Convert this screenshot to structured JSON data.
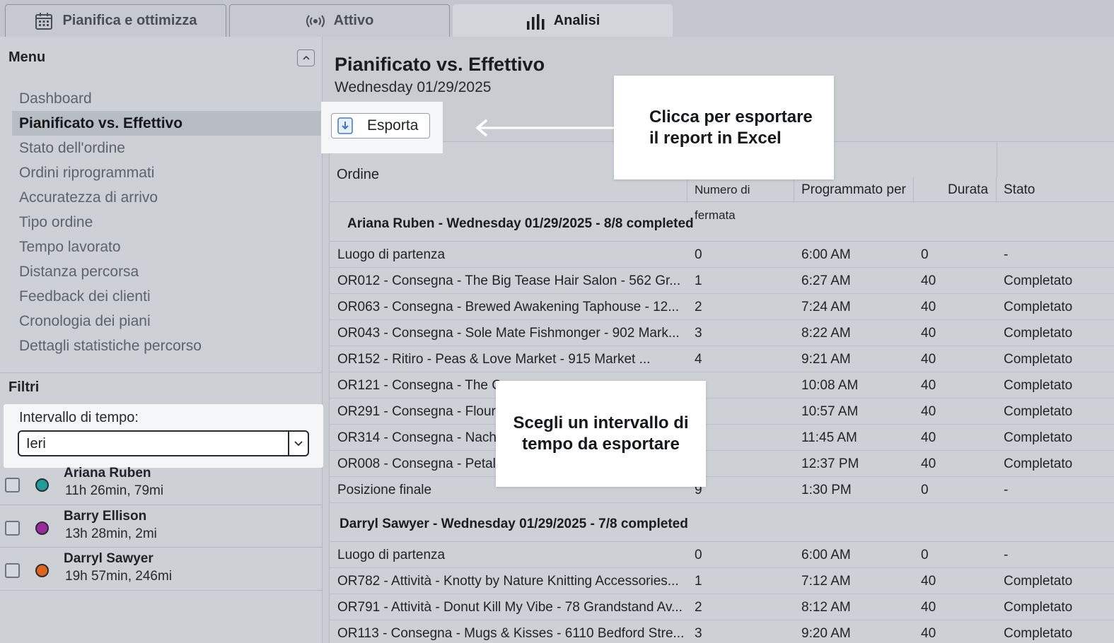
{
  "tabs": [
    {
      "label": "Pianifica e ottimizza",
      "icon": "calendar-icon"
    },
    {
      "label": "Attivo",
      "icon": "broadcast-icon"
    },
    {
      "label": "Analisi",
      "icon": "bar-chart-icon",
      "active": true
    }
  ],
  "sidebar": {
    "menu_title": "Menu",
    "items": [
      {
        "label": "Dashboard"
      },
      {
        "label": "Pianificato vs. Effettivo",
        "active": true
      },
      {
        "label": "Stato dell'ordine"
      },
      {
        "label": "Ordini riprogrammati"
      },
      {
        "label": "Accuratezza di arrivo"
      },
      {
        "label": "Tipo ordine"
      },
      {
        "label": "Tempo lavorato"
      },
      {
        "label": "Distanza percorsa"
      },
      {
        "label": "Feedback dei clienti"
      },
      {
        "label": "Cronologia dei piani"
      },
      {
        "label": "Dettagli statistiche percorso"
      }
    ],
    "filters_title": "Filtri",
    "time_range_label": "Intervallo di tempo:",
    "time_range_value": "Ieri",
    "drivers": [
      {
        "name": "Ariana Ruben",
        "stats": "11h 26min, 79mi",
        "color": "#1e9e99"
      },
      {
        "name": "Barry Ellison",
        "stats": "13h 28min, 2mi",
        "color": "#9b2a9e"
      },
      {
        "name": "Darryl Sawyer",
        "stats": "19h 57min, 246mi",
        "color": "#e0641c"
      }
    ]
  },
  "main": {
    "title": "Pianificato vs. Effettivo",
    "date": "Wednesday 01/29/2025",
    "export_label": "Esporta",
    "callout_export": "Clicca per esportare il report in Excel",
    "callout_range": "Scegli un intervallo di tempo da esportare",
    "columns": {
      "order": "Ordine",
      "stop": "Numero di fermata",
      "scheduled": "Programmato per",
      "duration": "Durata",
      "status": "Stato"
    },
    "groups": [
      {
        "title": "Ariana Ruben - Wednesday 01/29/2025 - 8/8 completed",
        "rows": [
          [
            "Luogo di partenza",
            "0",
            "6:00 AM",
            "0",
            "-"
          ],
          [
            "OR012 - Consegna - The Big Tease Hair Salon - 562 Gr...",
            "1",
            "6:27 AM",
            "40",
            "Completato"
          ],
          [
            "OR063 - Consegna - Brewed Awakening Taphouse - 12...",
            "2",
            "7:24 AM",
            "40",
            "Completato"
          ],
          [
            "OR043 - Consegna - Sole Mate Fishmonger - 902 Mark...",
            "3",
            "8:22 AM",
            "40",
            "Completato"
          ],
          [
            "OR152 - Ritiro - Peas & Love Market - 915 Market ...",
            "4",
            "9:21 AM",
            "40",
            "Completato"
          ],
          [
            "OR121 - Consegna - The C",
            "",
            "10:08 AM",
            "40",
            "Completato"
          ],
          [
            "OR291 - Consegna - Flourr",
            "",
            "10:57 AM",
            "40",
            "Completato"
          ],
          [
            "OR314 - Consegna - Nachr",
            "",
            "11:45 AM",
            "40",
            "Completato"
          ],
          [
            "OR008 - Consegna - Petale",
            "",
            "12:37 PM",
            "40",
            "Completato"
          ],
          [
            "Posizione finale",
            "9",
            "1:30 PM",
            "0",
            "-"
          ]
        ]
      },
      {
        "title": "Darryl Sawyer - Wednesday 01/29/2025 - 7/8 completed",
        "rows": [
          [
            "Luogo di partenza",
            "0",
            "6:00 AM",
            "0",
            "-"
          ],
          [
            "OR782 - Attività - Knotty by Nature Knitting Accessories...",
            "1",
            "7:12 AM",
            "40",
            "Completato"
          ],
          [
            "OR791 - Attività - Donut Kill My Vibe - 78 Grandstand Av...",
            "2",
            "8:12 AM",
            "40",
            "Completato"
          ],
          [
            "OR113 - Consegna - Mugs & Kisses - 6110 Bedford Stre...",
            "3",
            "9:20 AM",
            "40",
            "Completato"
          ]
        ]
      }
    ]
  }
}
